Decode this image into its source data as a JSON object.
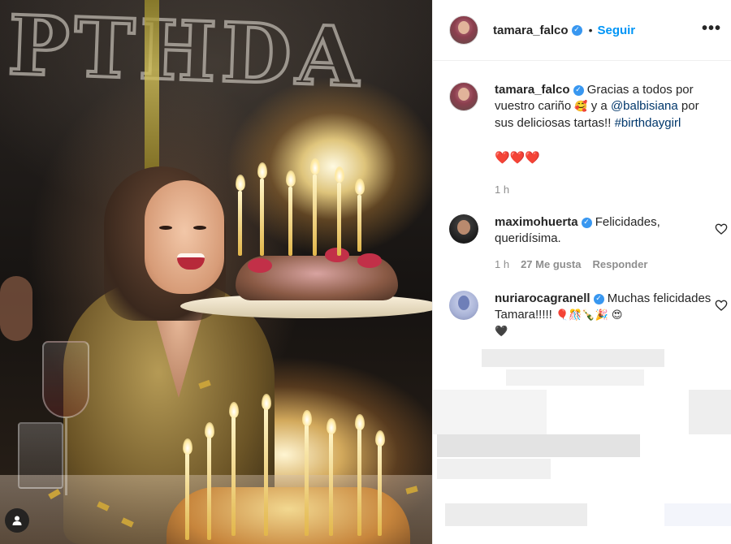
{
  "post": {
    "author": "tamara_falco",
    "follow_label": "Seguir",
    "separator": "•",
    "more_icon": "•••",
    "user_badge_icon": "user-silhouette-icon"
  },
  "caption": {
    "username": "tamara_falco",
    "text_before": "Gracias a todos por vuestro cariño",
    "emoji_1": "🥰",
    "text_middle": "y a",
    "mention": "@balbisiana",
    "text_after": "por sus deliciosas tartas!!",
    "hashtag": "#birthdaygirl",
    "hearts": "❤️❤️❤️",
    "time": "1 h"
  },
  "comments": [
    {
      "username": "maximohuerta",
      "text": "Felicidades, queridísima.",
      "time": "1 h",
      "likes": "27 Me gusta",
      "reply": "Responder"
    },
    {
      "username": "nuriarocagranell",
      "text": "Muchas felicidades Tamara!!!!!",
      "emojis": "🎈🎊🍾🎉 😍",
      "trailing": "🖤"
    }
  ],
  "colors": {
    "follow": "#0095f6",
    "verified": "#3897f0",
    "link": "#00376b",
    "meta": "#8e8e8e",
    "text": "#262626"
  }
}
